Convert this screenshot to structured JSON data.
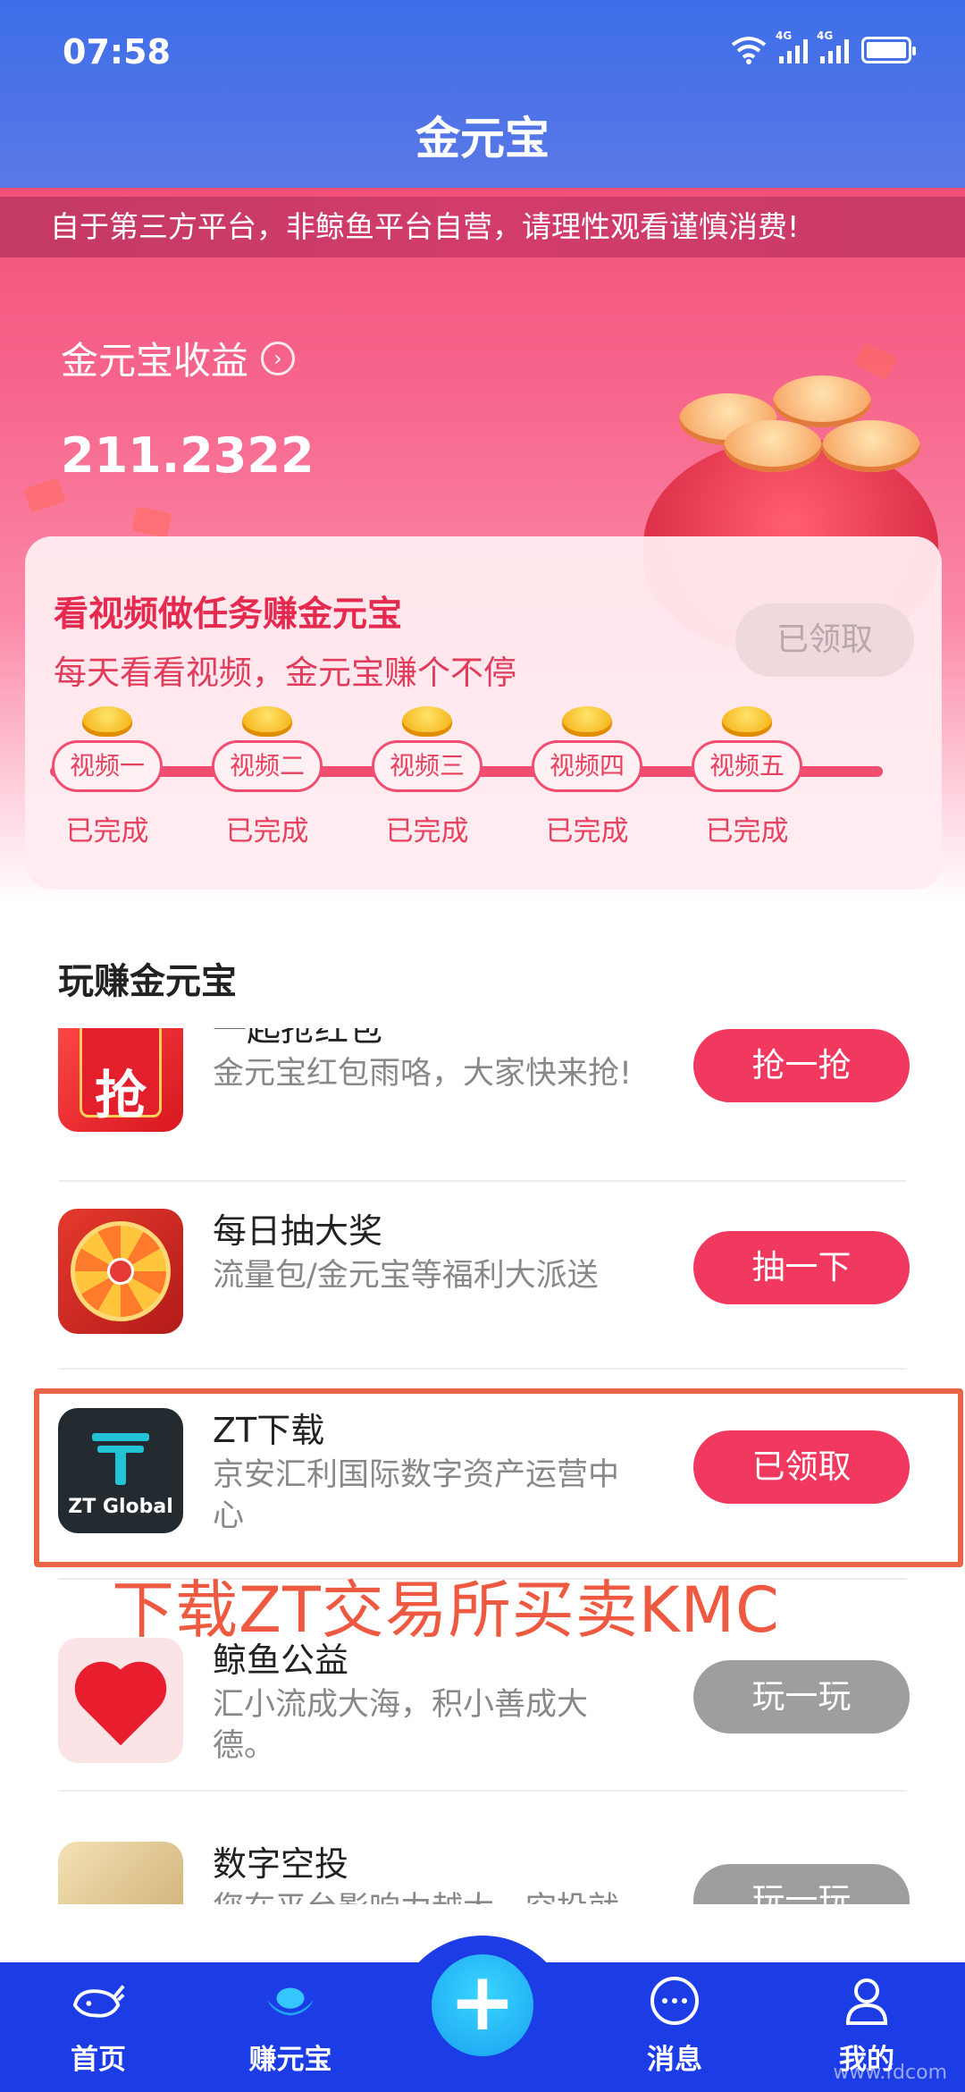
{
  "status_bar": {
    "time": "07:58",
    "net1": "4G",
    "net2": "4G"
  },
  "header": {
    "title": "金元宝"
  },
  "notice": {
    "text": "自于第三方平台，非鲸鱼平台自营，请理性观看谨慎消费!"
  },
  "earnings": {
    "label": "金元宝收益",
    "value": "211.2322"
  },
  "video_task": {
    "title": "看视频做任务赚金元宝",
    "subtitle": "每天看看视频，金元宝赚个不停",
    "button_label": "已领取",
    "steps": [
      {
        "label": "视频一",
        "status": "已完成"
      },
      {
        "label": "视频二",
        "status": "已完成"
      },
      {
        "label": "视频三",
        "status": "已完成"
      },
      {
        "label": "视频四",
        "status": "已完成"
      },
      {
        "label": "视频五",
        "status": "已完成"
      }
    ]
  },
  "play_section": {
    "title": "玩赚金元宝",
    "items": [
      {
        "name": "一起抢红包",
        "desc": "金元宝红包雨咯，大家快来抢!",
        "action": "抢一抢",
        "icon": "red-envelope-icon",
        "icon_text": "抢"
      },
      {
        "name": "每日抽大奖",
        "desc": "流量包/金元宝等福利大派送",
        "action": "抽一下",
        "icon": "prize-wheel-icon"
      },
      {
        "name": "ZT下载",
        "desc": "京安汇利国际数字资产运营中心",
        "action": "已领取",
        "icon": "zt-global-logo",
        "icon_text": "ZT Global"
      },
      {
        "name": "鲸鱼公益",
        "desc": "汇小流成大海，积小善成大德。",
        "action": "玩一玩",
        "icon": "heart-icon"
      },
      {
        "name": "数字空投",
        "desc": "您在平台影响力越大，空投就",
        "action": "玩一玩",
        "icon": "airdrop-icon"
      }
    ]
  },
  "overlay_caption": "下载ZT交易所买卖KMC",
  "bottom_nav": {
    "items": [
      {
        "label": "首页",
        "icon": "whale-icon"
      },
      {
        "label": "赚元宝",
        "icon": "ingot-icon"
      },
      {
        "label": "消息",
        "icon": "chat-bubble-icon"
      },
      {
        "label": "我的",
        "icon": "person-icon"
      }
    ],
    "center_icon": "plus-icon",
    "center_symbol": "+"
  },
  "watermark": "www.fdcom"
}
